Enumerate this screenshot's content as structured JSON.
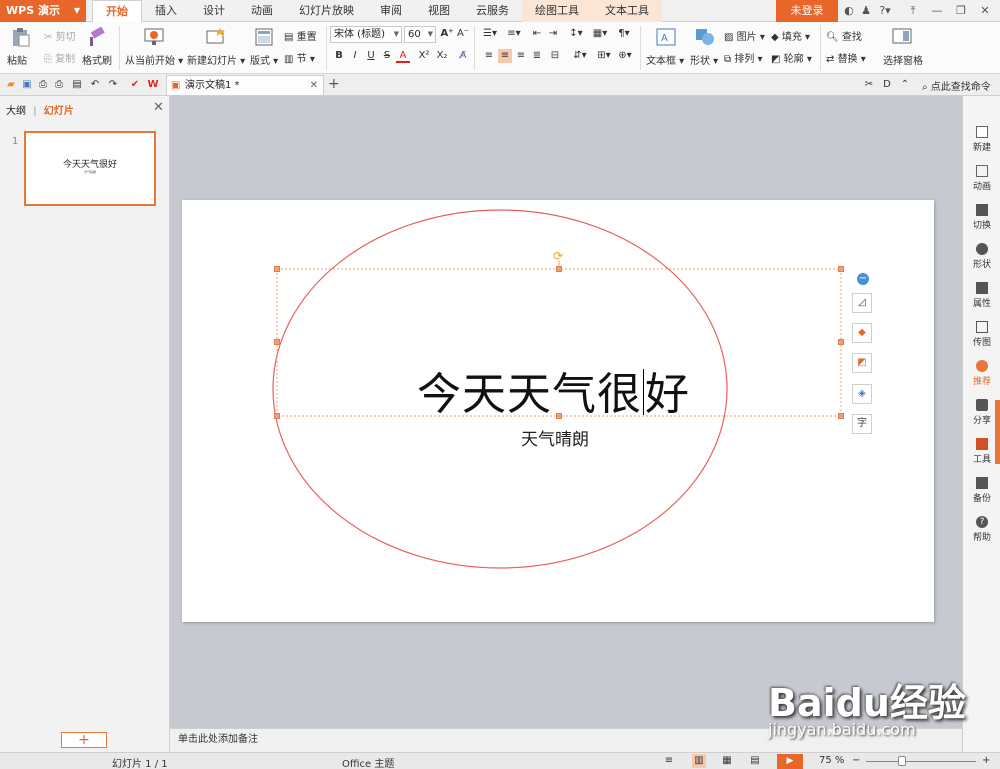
{
  "app": {
    "name": "WPS 演示",
    "login_label": "未登录"
  },
  "ribbon_tabs": [
    "开始",
    "插入",
    "设计",
    "动画",
    "幻灯片放映",
    "审阅",
    "视图",
    "云服务",
    "绘图工具",
    "文本工具"
  ],
  "ribbon": {
    "paste": "粘贴",
    "cut": "剪切",
    "copy": "复制",
    "format_painter": "格式刷",
    "from_current": "从当前开始",
    "new_slide": "新建幻灯片",
    "layout": "版式",
    "reset": "重置",
    "section": "节",
    "font_name": "宋体 (标题)",
    "font_size": "60",
    "bold": "B",
    "italic": "I",
    "underline": "U",
    "strike": "S",
    "font_color": "A",
    "superscript": "X²",
    "subscript": "X₂",
    "text_box": "文本框",
    "shape": "形状",
    "picture": "图片",
    "arrange": "排列",
    "fill": "填充",
    "outline": "轮廓",
    "find": "查找",
    "replace": "替换",
    "select_pane": "选择窗格"
  },
  "doc_tab": {
    "title": "演示文稿1 *"
  },
  "find_command_label": "点此查找命令",
  "left_panel": {
    "tab_outline": "大纲",
    "tab_slides": "幻灯片",
    "slide_number": "1",
    "thumb_title": "今天天气很好",
    "thumb_subtitle": "天气晴朗"
  },
  "slide": {
    "title_before_cursor": "今天天气很",
    "title_after_cursor": "好",
    "subtitle": "天气晴朗",
    "ellipse_color": "#e8605a"
  },
  "float_tools": [
    "minus-icon",
    "edit-shape-icon",
    "fill-icon",
    "outline-icon",
    "layers-icon",
    "font-style-icon"
  ],
  "notes_placeholder": "单击此处添加备注",
  "right_sidebar": [
    {
      "label": "新建",
      "icon": "new-icon"
    },
    {
      "label": "动画",
      "icon": "animation-icon"
    },
    {
      "label": "切换",
      "icon": "transition-icon"
    },
    {
      "label": "形状",
      "icon": "shape-icon"
    },
    {
      "label": "属性",
      "icon": "properties-icon"
    },
    {
      "label": "传图",
      "icon": "upload-image-icon"
    },
    {
      "label": "推荐",
      "icon": "recommend-icon"
    },
    {
      "label": "分享",
      "icon": "share-icon"
    },
    {
      "label": "工具",
      "icon": "toolbox-icon"
    },
    {
      "label": "备份",
      "icon": "backup-icon"
    },
    {
      "label": "帮助",
      "icon": "help-icon"
    }
  ],
  "status": {
    "slide_info": "幻灯片 1 / 1",
    "theme": "Office 主题",
    "zoom": "75 %"
  },
  "watermark": {
    "logo_text": "Baidu经验",
    "url": "jingyan.baidu.com"
  },
  "colors": {
    "accent": "#e8662a"
  }
}
